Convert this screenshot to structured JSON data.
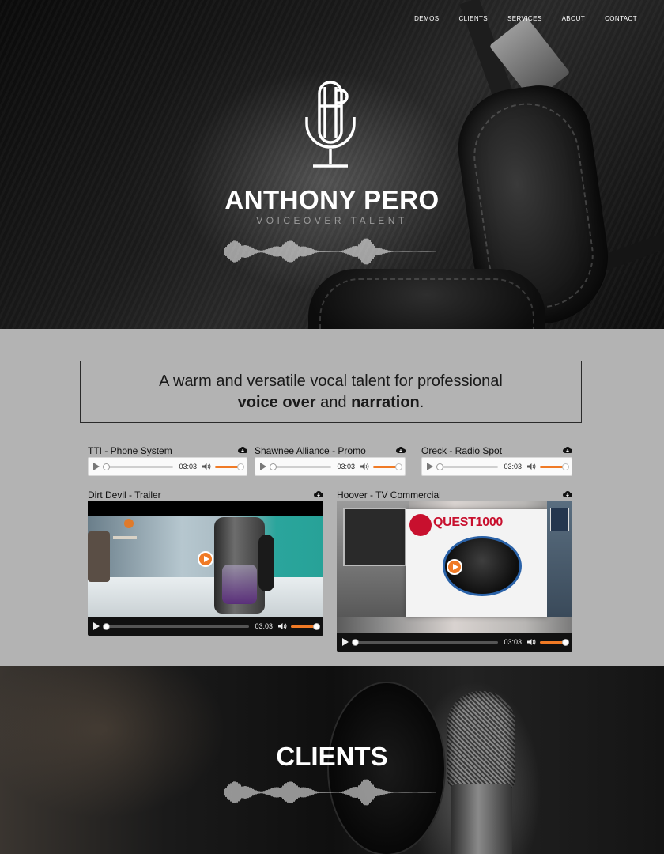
{
  "nav": {
    "items": [
      {
        "label": "DEMOS"
      },
      {
        "label": "CLIENTS"
      },
      {
        "label": "SERVICES"
      },
      {
        "label": "ABOUT"
      },
      {
        "label": "CONTACT"
      }
    ]
  },
  "hero": {
    "name": "ANTHONY PERO",
    "tagline": "VOICEOVER TALENT",
    "logo_letters": "AP"
  },
  "intro": {
    "line1": "A warm and versatile vocal talent for professional",
    "bold1": "voice over",
    "mid": "and",
    "bold2": "narration",
    "end": "."
  },
  "audio_demos": [
    {
      "title": "TTI - Phone System",
      "duration": "03:03",
      "progress": 0,
      "volume": 1
    },
    {
      "title": "Shawnee Alliance - Promo",
      "duration": "03:03",
      "progress": 0,
      "volume": 1
    },
    {
      "title": "Oreck - Radio Spot",
      "duration": "03:03",
      "progress": 0,
      "volume": 1
    }
  ],
  "video_demos": [
    {
      "title": "Dirt Devil - Trailer",
      "duration": "03:03",
      "progress": 0,
      "volume": 1
    },
    {
      "title": "Hoover - TV Commercial",
      "duration": "03:03",
      "progress": 0,
      "volume": 1,
      "product_text": "QUEST1000"
    }
  ],
  "clients": {
    "title": "CLIENTS"
  },
  "icons": {
    "download": "cloud-download-icon",
    "play": "play-icon",
    "volume": "volume-icon"
  },
  "colors": {
    "accent": "#f07a25",
    "section_bg": "#b3b3b3",
    "hero_text": "#ffffff"
  }
}
